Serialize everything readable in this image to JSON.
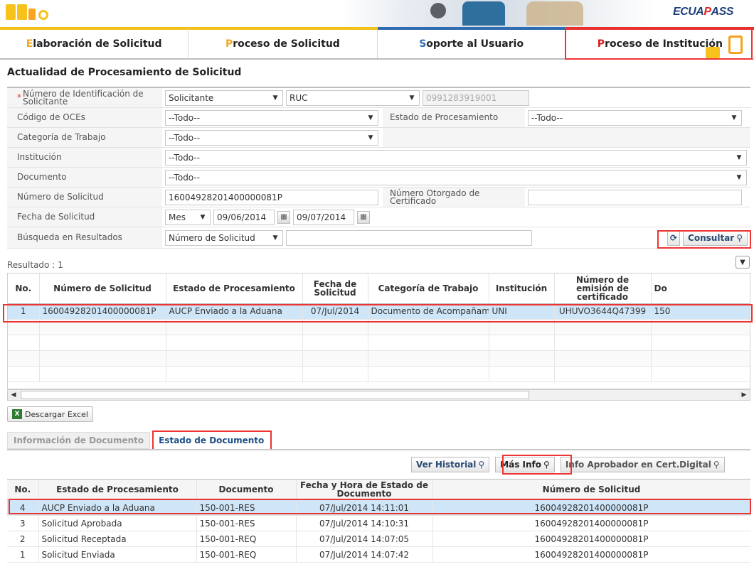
{
  "brand": {
    "logo": "ECUAPASS"
  },
  "nav": {
    "items": [
      {
        "first": "E",
        "rest": "laboración de Solicitud"
      },
      {
        "first": "P",
        "rest": "roceso de Solicitud"
      },
      {
        "first": "S",
        "rest": "oporte al Usuario"
      },
      {
        "first": "P",
        "rest": "roceso de Institución"
      }
    ]
  },
  "page": {
    "title": "Actualidad de Procesamiento de Solicitud"
  },
  "form": {
    "id_label": "Número de Identificación de Solicitante",
    "id_type": "Solicitante",
    "id_doc": "RUC",
    "id_value": "0991283919001",
    "oce_label": "Código de OCEs",
    "oce_value": "--Todo--",
    "estado_label": "Estado de Procesamiento",
    "estado_value": "--Todo--",
    "cat_label": "Categoría de Trabajo",
    "cat_value": "--Todo--",
    "inst_label": "Institución",
    "inst_value": "--Todo--",
    "doc_label": "Documento",
    "doc_value": "--Todo--",
    "nsol_label": "Número de Solicitud",
    "nsol_value": "16004928201400000081P",
    "cert_label": "Número Otorgado de Certificado",
    "cert_value": "",
    "fecha_label": "Fecha de Solicitud",
    "fecha_mode": "Mes",
    "fecha_from": "09/06/2014",
    "fecha_to": "09/07/2014",
    "busq_label": "Búsqueda en Resultados",
    "busq_field": "Número de Solicitud",
    "busq_value": "",
    "consultar": "Consultar"
  },
  "result": {
    "label": "Resultado : 1",
    "headers": [
      "No.",
      "Número de Solicitud",
      "Estado de Procesamiento",
      "Fecha de Solicitud",
      "Categoría de Trabajo",
      "Institución",
      "Número de emisión de certificado",
      "Do"
    ],
    "rows": [
      [
        "1",
        "16004928201400000081P",
        "AUCP Enviado a la Aduana",
        "07/Jul/2014",
        "Documento de Acompañamier",
        "UNI",
        "UHUVO3644Q47399",
        "150"
      ]
    ]
  },
  "excel": {
    "label": "Descargar Excel"
  },
  "tabs": {
    "info": "Información de Documento",
    "estado": "Estado de Documento"
  },
  "actions": {
    "historial": "Ver Historial",
    "masinfo": "Más Info",
    "aprobador": "Info Aprobador en Cert.Digital"
  },
  "estado": {
    "headers": [
      "No.",
      "Estado de Procesamiento",
      "Documento",
      "Fecha y Hora de Estado de Documento",
      "Número de Solicitud"
    ],
    "rows": [
      [
        "4",
        "AUCP Enviado a la Aduana",
        "150-001-RES",
        "07/Jul/2014 14:11:01",
        "16004928201400000081P"
      ],
      [
        "3",
        "Solicitud Aprobada",
        "150-001-RES",
        "07/Jul/2014 14:10:31",
        "16004928201400000081P"
      ],
      [
        "2",
        "Solicitud Receptada",
        "150-001-REQ",
        "07/Jul/2014 14:07:05",
        "16004928201400000081P"
      ],
      [
        "1",
        "Solicitud Enviada",
        "150-001-REQ",
        "07/Jul/2014 14:07:42",
        "16004928201400000081P"
      ]
    ]
  }
}
